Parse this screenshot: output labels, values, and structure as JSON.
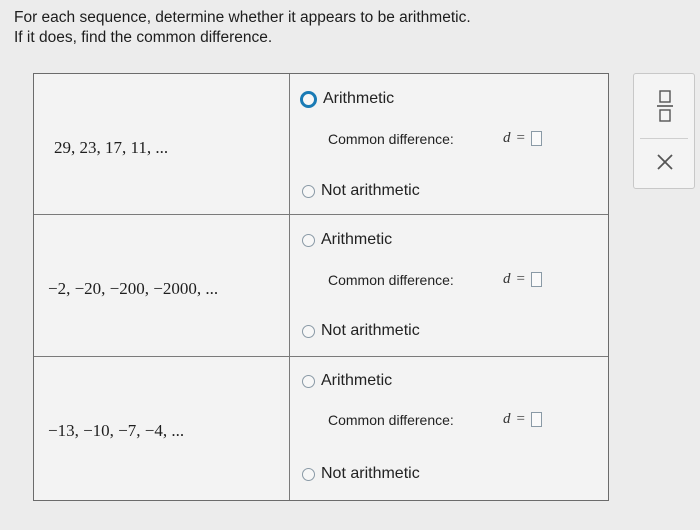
{
  "instructions": {
    "line1": "For each sequence, determine whether it appears to be arithmetic.",
    "line2": "If it does, find the common difference."
  },
  "rows": [
    {
      "sequence": "29, 23, 17, 11, ...",
      "option_arithmetic": "Arithmetic",
      "common_difference_label": "Common difference:",
      "d_var": "d",
      "d_eq": "=",
      "option_not_arithmetic": "Not arithmetic"
    },
    {
      "sequence": "−2, −20, −200, −2000, ...",
      "option_arithmetic": "Arithmetic",
      "common_difference_label": "Common difference:",
      "d_var": "d",
      "d_eq": "=",
      "option_not_arithmetic": "Not arithmetic"
    },
    {
      "sequence": "−13, −10, −7, −4, ...",
      "option_arithmetic": "Arithmetic",
      "common_difference_label": "Common difference:",
      "d_var": "d",
      "d_eq": "=",
      "option_not_arithmetic": "Not arithmetic"
    }
  ],
  "side_panel": {
    "icons": [
      "fraction-icon",
      "close-icon"
    ]
  },
  "colors": {
    "focus_ring": "#1a7bb5",
    "radio_border": "#8a9aa6",
    "background": "#ececec"
  }
}
